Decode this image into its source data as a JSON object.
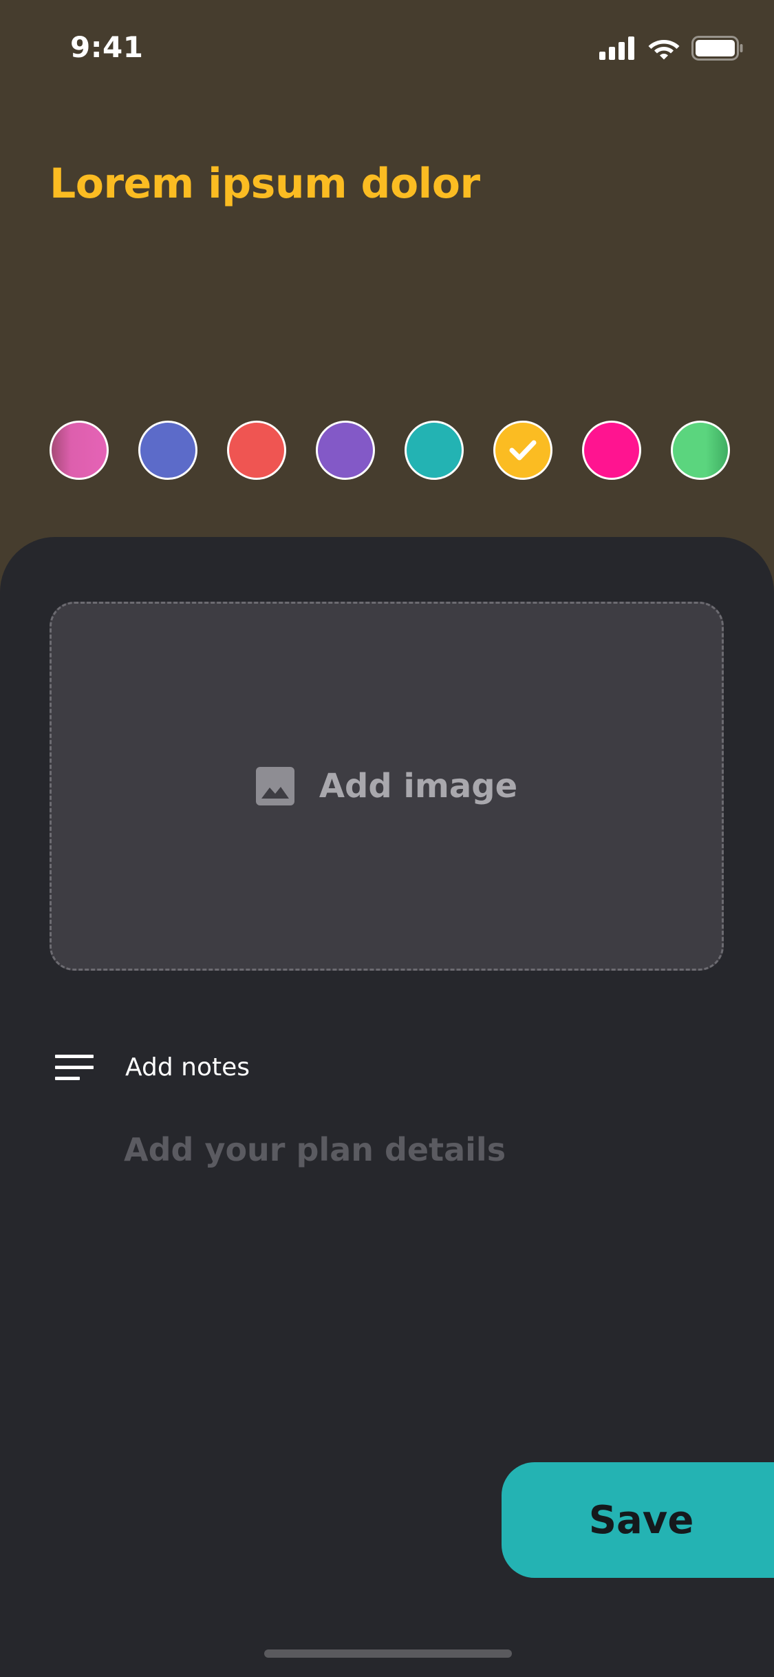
{
  "status_bar": {
    "time": "9:41",
    "icons": [
      "signal-icon",
      "wifi-icon",
      "battery-icon"
    ]
  },
  "header": {
    "title": "Lorem ipsum dolor",
    "title_color": "#fbbc22"
  },
  "colors": [
    {
      "name": "pink-gradient",
      "hex": "#e062b1",
      "selected": false
    },
    {
      "name": "indigo",
      "hex": "#5c6bc9",
      "selected": false
    },
    {
      "name": "red",
      "hex": "#ef5552",
      "selected": false
    },
    {
      "name": "purple",
      "hex": "#8359c7",
      "selected": false
    },
    {
      "name": "teal",
      "hex": "#23b3b3",
      "selected": false
    },
    {
      "name": "amber",
      "hex": "#fbbc22",
      "selected": true
    },
    {
      "name": "magenta",
      "hex": "#ff1490",
      "selected": false
    },
    {
      "name": "green",
      "hex": "#5bd57e",
      "selected": false
    }
  ],
  "image_picker": {
    "label": "Add image",
    "icon": "image-icon"
  },
  "notes": {
    "label": "Add notes",
    "icon": "text-lines-icon",
    "value": "",
    "placeholder": "Add your plan details"
  },
  "actions": {
    "save_label": "Save",
    "save_color": "#24b3b3"
  },
  "theme": {
    "header_bg": "#463d2e",
    "sheet_bg": "#26272c"
  }
}
